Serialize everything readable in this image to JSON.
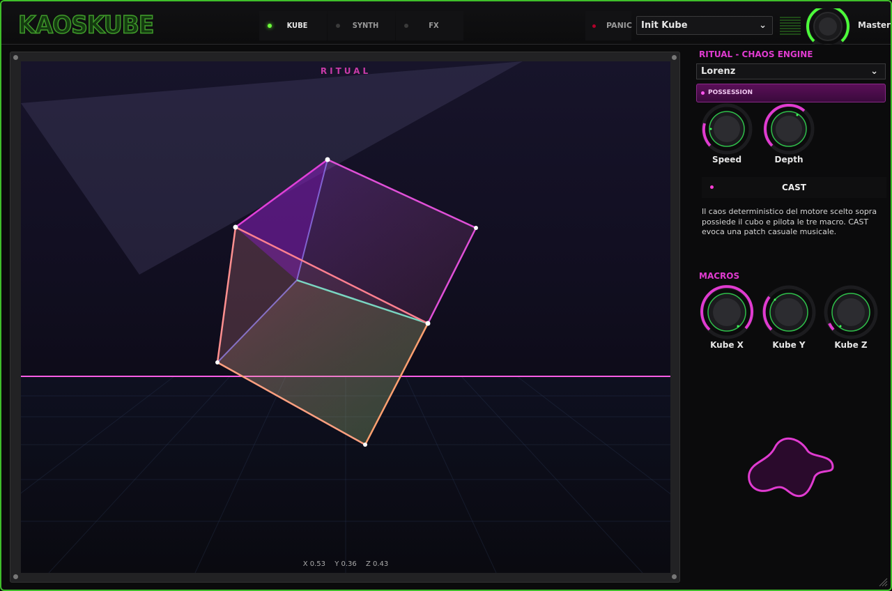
{
  "app": {
    "logo": "KAOSKUBE"
  },
  "header": {
    "tabs": [
      {
        "label": "KUBE",
        "active": true
      },
      {
        "label": "SYNTH",
        "active": false
      },
      {
        "label": "FX",
        "active": false
      }
    ],
    "panic_label": "PANIC",
    "preset": "Init Kube",
    "master_label": "Master"
  },
  "viewport": {
    "title": "RITUAL",
    "coords": {
      "x": "X 0.53",
      "y": "Y 0.36",
      "z": "Z 0.43"
    }
  },
  "ritual": {
    "title": "RITUAL - CHAOS ENGINE",
    "engine": "Lorenz",
    "possession_label": "POSSESSION",
    "knobs": [
      {
        "label": "Speed"
      },
      {
        "label": "Depth"
      }
    ],
    "cast_label": "CAST",
    "description": "Il caos deterministico del motore scelto sopra possiede il cubo e pilota le tre macro. CAST evoca una patch casuale musicale."
  },
  "macros": {
    "title": "MACROS",
    "knobs": [
      {
        "label": "Kube X"
      },
      {
        "label": "Kube Y"
      },
      {
        "label": "Kube Z"
      }
    ]
  },
  "colors": {
    "accent": "#e03bd0",
    "green": "#3fbf2a",
    "knob_ring": "#2fbf4a"
  }
}
